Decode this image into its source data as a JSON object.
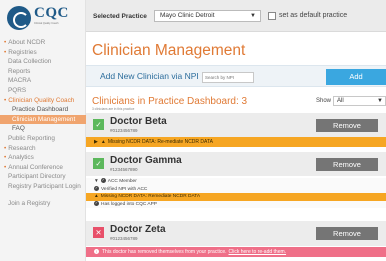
{
  "logo": {
    "text": "CQC",
    "subtitle": "Clinical Quality Coach"
  },
  "sidebar": {
    "items": [
      {
        "label": "About NCDR",
        "bullet": true,
        "level": 0,
        "state": "normal"
      },
      {
        "label": "Registries",
        "bullet": true,
        "level": 0,
        "state": "normal"
      },
      {
        "label": "Data Collection",
        "bullet": false,
        "level": 1,
        "state": "normal"
      },
      {
        "label": "Reports",
        "bullet": false,
        "level": 1,
        "state": "normal"
      },
      {
        "label": "MACRA",
        "bullet": false,
        "level": 1,
        "state": "normal"
      },
      {
        "label": "PQRS",
        "bullet": false,
        "level": 1,
        "state": "normal"
      },
      {
        "label": "Clinician Quality Coach",
        "bullet": true,
        "level": 0,
        "state": "active"
      },
      {
        "label": "Practice Dashboard",
        "bullet": false,
        "level": 2,
        "state": "plain"
      },
      {
        "label": "Clinician Management",
        "bullet": false,
        "level": 2,
        "state": "current"
      },
      {
        "label": "FAQ",
        "bullet": false,
        "level": 2,
        "state": "plain"
      },
      {
        "label": "Public Reporting",
        "bullet": false,
        "level": 1,
        "state": "normal"
      },
      {
        "label": "Research",
        "bullet": true,
        "level": 0,
        "state": "normal"
      },
      {
        "label": "Analytics",
        "bullet": true,
        "level": 0,
        "state": "normal"
      },
      {
        "label": "Annual Conference",
        "bullet": true,
        "level": 0,
        "state": "normal"
      },
      {
        "label": "Participant Directory",
        "bullet": false,
        "level": 1,
        "state": "normal"
      },
      {
        "label": "Registry Participant Login",
        "bullet": false,
        "level": 1,
        "state": "normal",
        "twoline": true
      },
      {
        "label": "Join a Registry",
        "bullet": false,
        "level": 1,
        "state": "normal"
      }
    ]
  },
  "topbar": {
    "practice_label": "Selected Practice",
    "practice_value": "Mayo Clinic Detroit",
    "default_label": "set as default practice"
  },
  "main": {
    "title": "Clinician Management",
    "add_label": "Add New Clinician via NPI",
    "npi_placeholder": "Search by NPI",
    "add_button": "Add",
    "dashboard_title": "Clinicians in Practice Dashboard: 3",
    "dashboard_subtitle": "3 clinicians are in this practice",
    "show_label": "Show",
    "show_value": "All"
  },
  "doctors": [
    {
      "name": "Doctor Beta",
      "npi": "#0123456789",
      "remove_label": "Remove",
      "warning": "Missing NCDR DATA: Re-mediate NCDR DATA"
    },
    {
      "name": "Doctor Gamma",
      "npi": "#1234567890",
      "remove_label": "Remove",
      "details": [
        "ACC Member",
        "Verified NPI with ACC",
        "Missing NCDR DATA: Remediate NCDR DATA",
        "Has logged into CQC APP"
      ]
    },
    {
      "name": "Doctor Zeta",
      "npi": "#0123456789",
      "remove_label": "Remove",
      "notice": "This doctor has removed themselves from your practice.",
      "notice_link": "Click here to re-add them."
    }
  ],
  "colors": {
    "accent_orange": "#e07a35",
    "add_blue": "#3aa7e0",
    "check_green": "#5cb85c",
    "warning_amber": "#f6a623",
    "removed_pink": "#ef6f88",
    "remove_gray": "#757575"
  }
}
